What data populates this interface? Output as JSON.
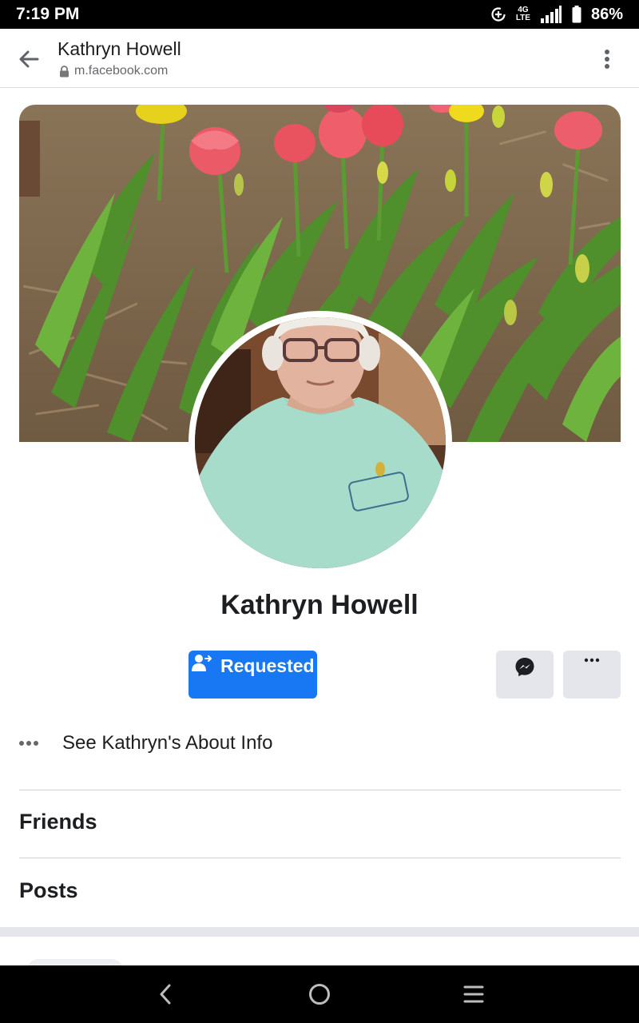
{
  "status_bar": {
    "time": "7:19 PM",
    "network_top": "4G",
    "network_bottom": "LTE",
    "battery": "86%"
  },
  "browser": {
    "title": "Kathryn Howell",
    "url": "m.facebook.com"
  },
  "profile": {
    "name": "Kathryn Howell",
    "requested_label": "Requested",
    "about_label": "See Kathryn's About Info"
  },
  "sections": {
    "friends": "Friends",
    "posts": "Posts"
  },
  "colors": {
    "primary_blue": "#1877f2",
    "button_gray": "#e4e6eb",
    "text_dark": "#1c1e21",
    "text_muted": "#65676b"
  },
  "icons": [
    "data-saver-icon",
    "signal-icon",
    "battery-icon",
    "back-arrow-icon",
    "lock-icon",
    "kebab-menu-icon",
    "add-friend-requested-icon",
    "messenger-icon",
    "more-icon",
    "nav-back-icon",
    "nav-home-icon",
    "nav-recents-icon"
  ]
}
